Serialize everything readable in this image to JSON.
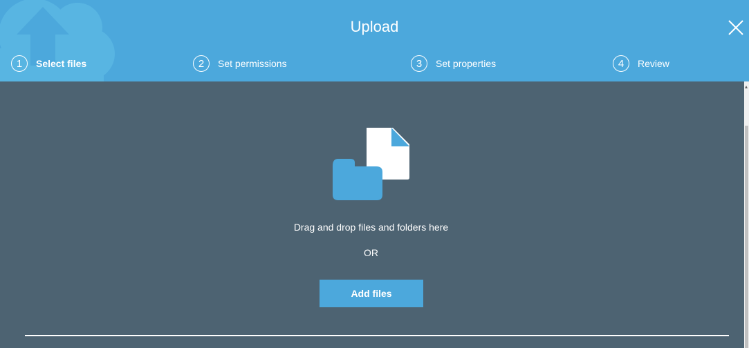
{
  "header": {
    "title": "Upload",
    "background_color": "#4ca8dc",
    "close_icon": "close-icon"
  },
  "steps": [
    {
      "number": "1",
      "label": "Select files",
      "active": true
    },
    {
      "number": "2",
      "label": "Set permissions",
      "active": false
    },
    {
      "number": "3",
      "label": "Set properties",
      "active": false
    },
    {
      "number": "4",
      "label": "Review",
      "active": false
    }
  ],
  "dropzone": {
    "instruction": "Drag and drop files and folders here",
    "separator": "OR",
    "add_button_label": "Add files",
    "icons": [
      "folder-icon",
      "document-icon"
    ],
    "background_color": "#4d6372",
    "accent_color": "#4ca8dc"
  }
}
